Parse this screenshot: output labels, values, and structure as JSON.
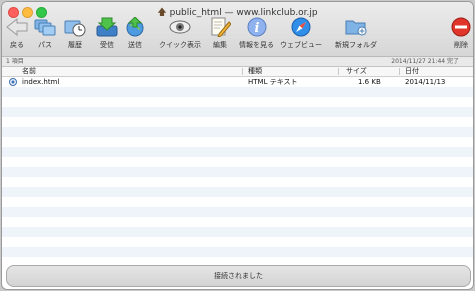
{
  "window": {
    "title": "public_html — www.linkclub.or.jp"
  },
  "toolbar": {
    "back": "戻る",
    "path": "パス",
    "history": "履歴",
    "download": "受信",
    "upload": "送信",
    "quick_look": "クイック表示",
    "edit": "編集",
    "info": "情報を見る",
    "web_view": "ウェブビュー",
    "new_folder": "新規フォルダ",
    "delete": "削除"
  },
  "infobar": {
    "count": "1 項目",
    "status": "2014/11/27 21:44 完了"
  },
  "columns": {
    "name": "名前",
    "kind": "種類",
    "size": "サイズ",
    "date": "日付"
  },
  "files": [
    {
      "name": "index.html",
      "kind": "HTML テキスト",
      "size": "1.6 KB",
      "date": "2014/11/13"
    }
  ],
  "statusbar": {
    "message": "接続されました"
  }
}
